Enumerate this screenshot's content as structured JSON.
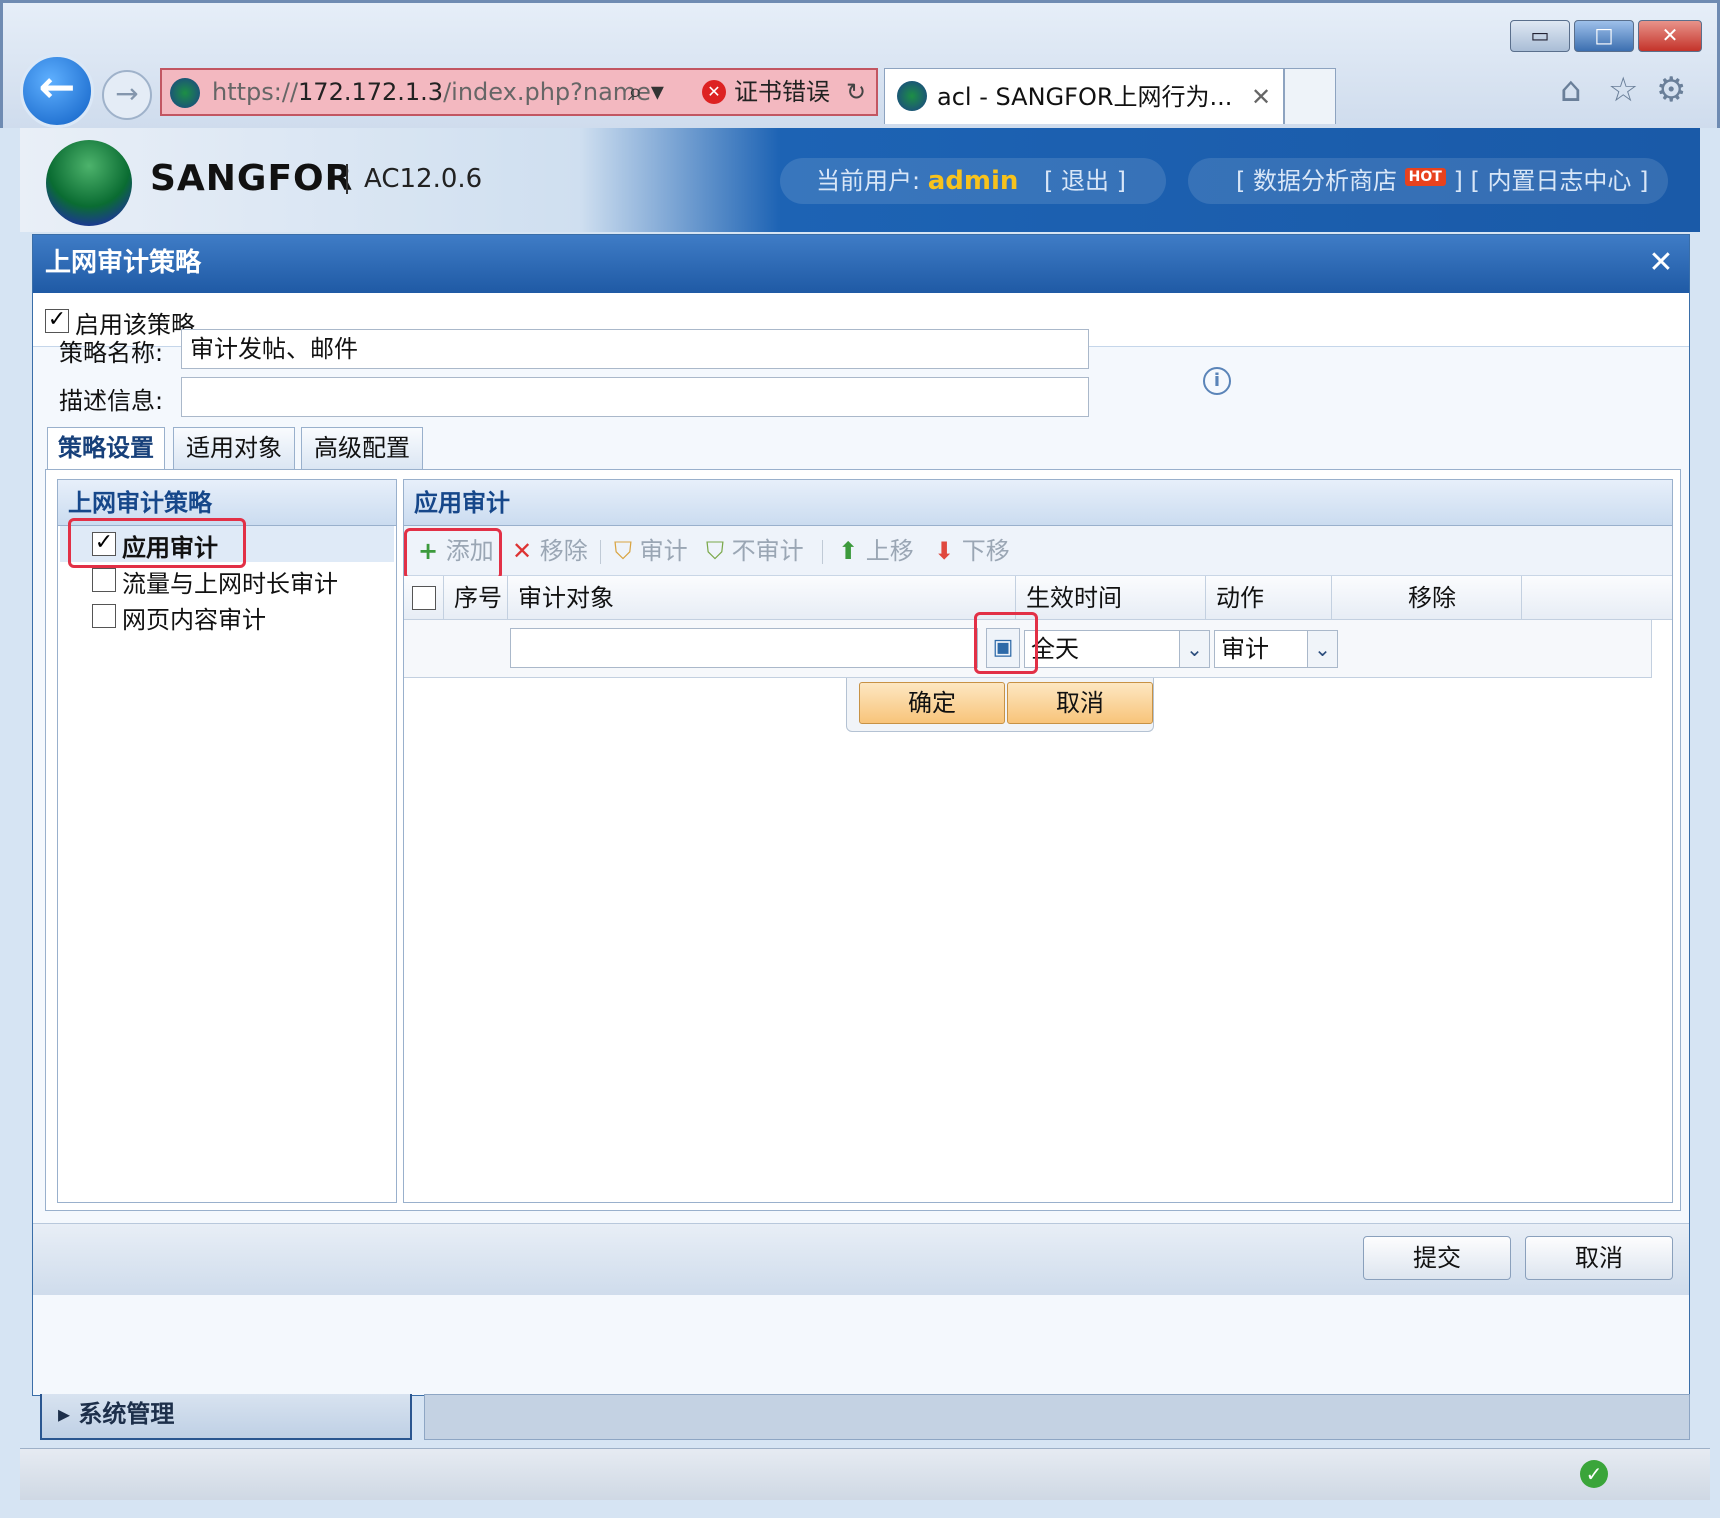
{
  "browser": {
    "url_prefix": "https://",
    "url_host": "172.172.1.3",
    "url_rest": "/index.php?name",
    "cert_error": "证书错误",
    "tab_title": "acl - SANGFOR上网行为...",
    "icons": {
      "back": "back-arrow-icon",
      "forward": "forward-arrow-icon",
      "home": "home-icon",
      "favorites": "star-icon",
      "settings": "gear-icon"
    }
  },
  "app": {
    "brand": "SANGFOR",
    "version": "AC12.0.6",
    "user_label": "当前用户:",
    "user": "admin",
    "logout": "[ 退出 ]",
    "data_shop": "[ 数据分析商店",
    "hot": "HOT",
    "log_center": "] [ 内置日志中心 ]"
  },
  "dialog": {
    "title": "上网审计策略",
    "enable_label": "启用该策略",
    "enable_checked": true,
    "name_label": "策略名称:",
    "name_value": "审计发帖、邮件",
    "desc_label": "描述信息:",
    "desc_value": "",
    "tabs": [
      "策略设置",
      "适用对象",
      "高级配置"
    ],
    "tree": {
      "header": "上网审计策略",
      "items": [
        {
          "label": "应用审计",
          "checked": true
        },
        {
          "label": "流量与上网时长审计",
          "checked": false
        },
        {
          "label": "网页内容审计",
          "checked": false
        }
      ]
    },
    "panel": {
      "header": "应用审计",
      "toolbar": {
        "add": "添加",
        "remove": "移除",
        "audit": "审计",
        "no_audit": "不审计",
        "up": "上移",
        "down": "下移"
      },
      "columns": [
        "序号",
        "审计对象",
        "生效时间",
        "动作",
        "移除"
      ],
      "edit_row": {
        "object": "",
        "time": "全天",
        "action": "审计"
      },
      "confirm": "确定",
      "cancel": "取消"
    },
    "submit": "提交",
    "cancel": "取消"
  },
  "nav": {
    "system_management": "系统管理"
  },
  "colors": {
    "highlight_box": "#e23046",
    "title_bar": "#1f5aa5",
    "accent_button": "#f8c47a"
  }
}
